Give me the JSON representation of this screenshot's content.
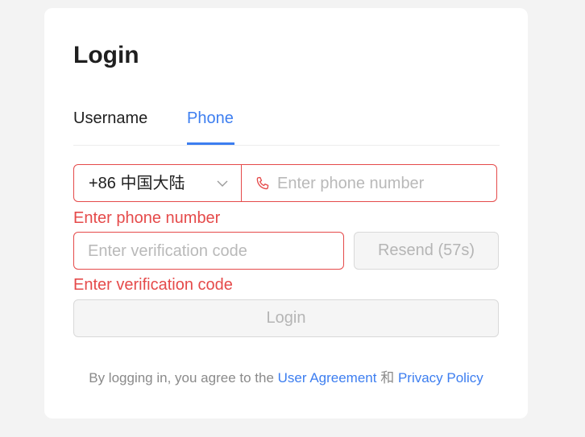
{
  "login": {
    "title": "Login",
    "tabs": [
      {
        "label": "Username",
        "active": false
      },
      {
        "label": "Phone",
        "active": true
      }
    ],
    "country_code": "+86 中国大陆",
    "phone_placeholder": "Enter phone number",
    "phone_error": "Enter phone number",
    "code_placeholder": "Enter verification code",
    "resend_label": "Resend (57s)",
    "code_error": "Enter verification code",
    "submit_label": "Login",
    "agreement": {
      "prefix": "By logging in, you agree to the ",
      "user_agreement": "User Agreement",
      "connector": " 和 ",
      "privacy_policy": "Privacy Policy"
    }
  },
  "colors": {
    "accent": "#3d7ef0",
    "error": "#e54a4a",
    "disabled_text": "#b5b5b5"
  },
  "icons": {
    "country_dropdown": "chevron-down-icon",
    "phone_field": "phone-icon"
  }
}
